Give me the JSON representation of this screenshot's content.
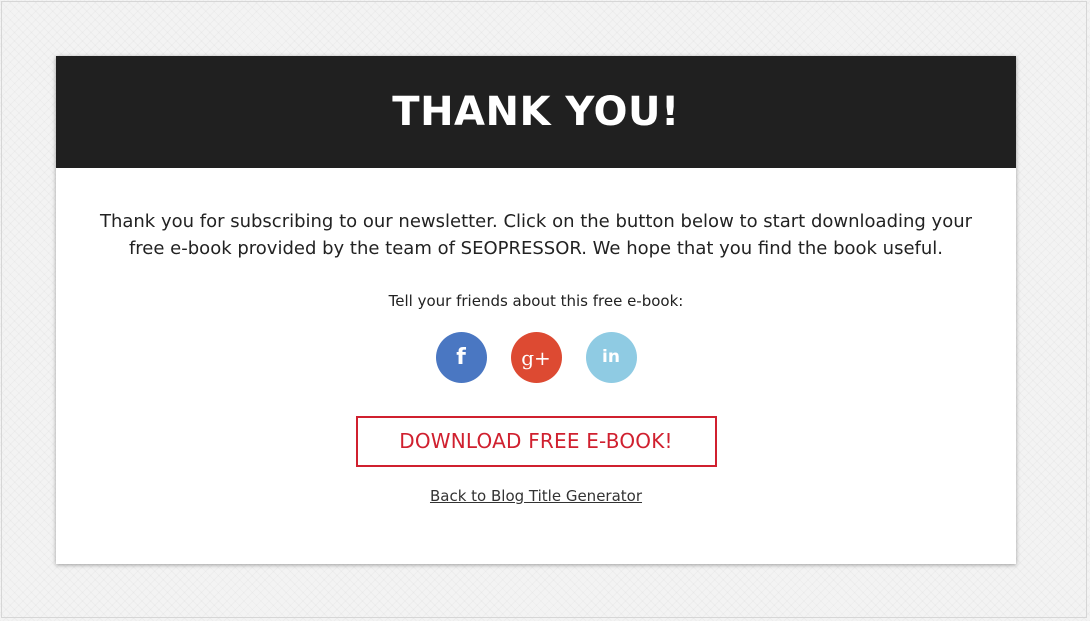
{
  "header": {
    "title": "THANK YOU!"
  },
  "body": {
    "intro_text": "Thank you for subscribing to our newsletter. Click on the button below to start downloading your free e-book provided by the team of SEOPRESSOR. We hope that you find the book useful.",
    "share_prompt": "Tell your friends about this free e-book:"
  },
  "social": [
    {
      "icon": "facebook-icon",
      "glyph": "f",
      "color": "#4a77c2"
    },
    {
      "icon": "google-plus-icon",
      "glyph": "g+",
      "color": "#dd4a32"
    },
    {
      "icon": "linkedin-icon",
      "glyph": "in",
      "color": "#8fcbe3"
    }
  ],
  "actions": {
    "download_label": "DOWNLOAD FREE E-BOOK!",
    "back_link_label": "Back to Blog Title Generator"
  },
  "colors": {
    "header_bg": "#202020",
    "accent_red": "#d0202f"
  }
}
